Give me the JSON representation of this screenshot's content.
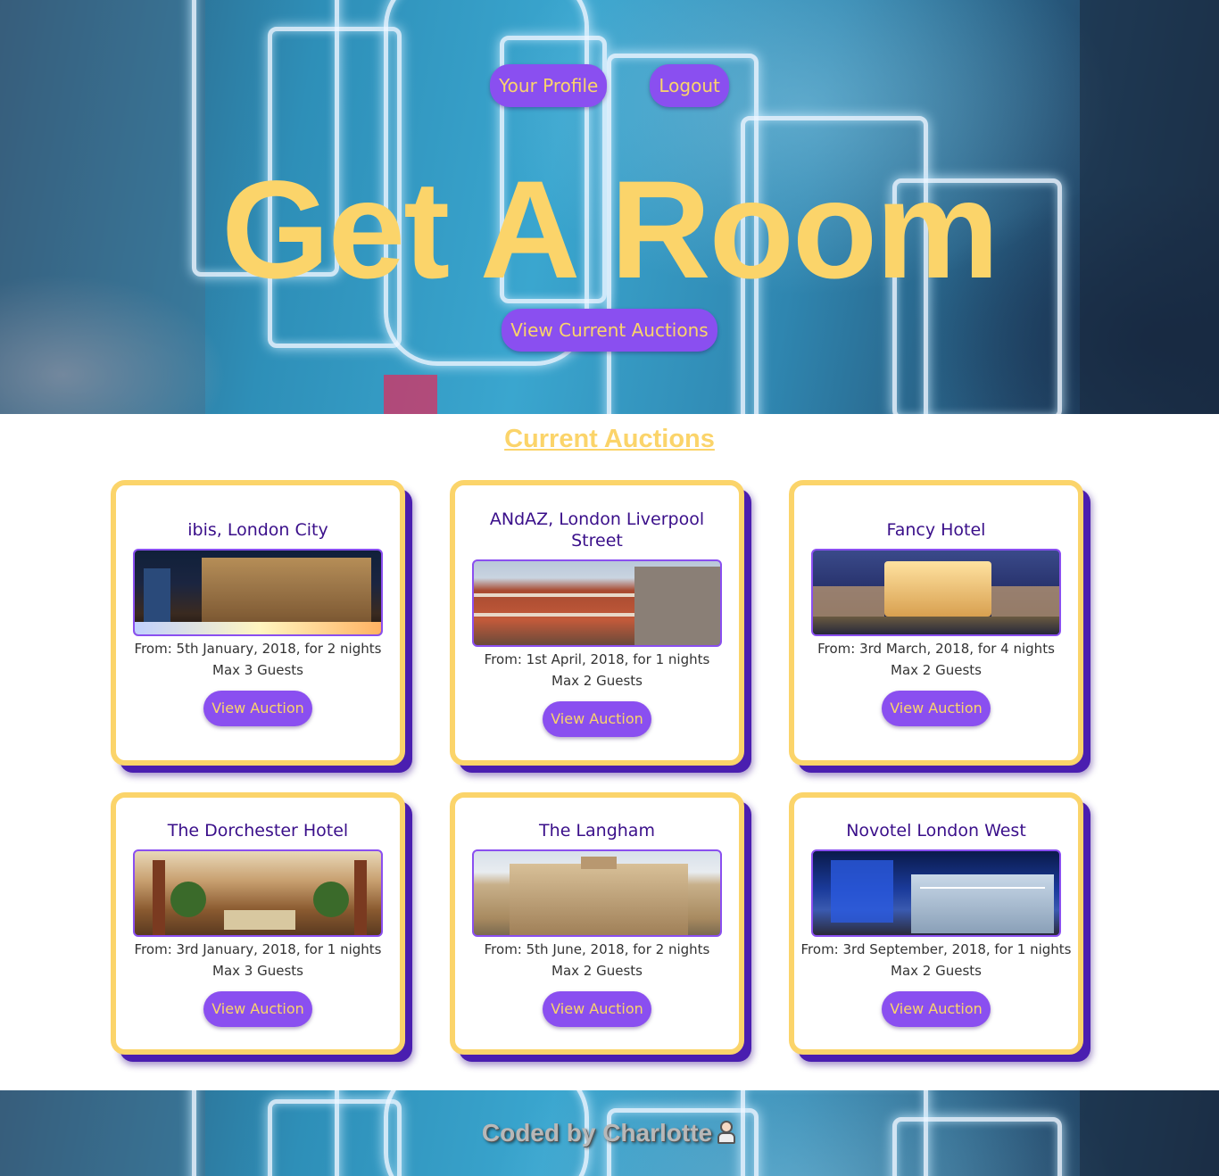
{
  "nav": {
    "profile_label": "Your Profile",
    "logout_label": "Logout"
  },
  "hero": {
    "title": "Get A Room",
    "cta_label": "View Current Auctions"
  },
  "section": {
    "title": "Current Auctions"
  },
  "auctions": [
    {
      "name": "ibis, London City",
      "from": "From: 5th January, 2018, for 2 nights",
      "guests": "Max 3 Guests",
      "button": "View Auction",
      "image": "city-night-hotel-photo"
    },
    {
      "name": "ANdAZ, London Liverpool Street",
      "from": "From: 1st April, 2018, for 1 nights",
      "guests": "Max 2 Guests",
      "button": "View Auction",
      "image": "red-brick-hotel-photo"
    },
    {
      "name": "Fancy Hotel",
      "from": "From: 3rd March, 2018, for 4 nights",
      "guests": "Max 2 Guests",
      "button": "View Auction",
      "image": "lit-palace-hotel-photo"
    },
    {
      "name": "The Dorchester Hotel",
      "from": "From: 3rd January, 2018, for 1 nights",
      "guests": "Max 3 Guests",
      "button": "View Auction",
      "image": "lobby-interior-photo"
    },
    {
      "name": "The Langham",
      "from": "From: 5th June, 2018, for 2 nights",
      "guests": "Max 2 Guests",
      "button": "View Auction",
      "image": "stone-facade-hotel-photo"
    },
    {
      "name": "Novotel London West",
      "from": "From: 3rd September, 2018, for 1 nights",
      "guests": "Max 2 Guests",
      "button": "View Auction",
      "image": "glass-modern-hotel-photo"
    }
  ],
  "footer": {
    "credit": "Coded by Charlotte",
    "emoji": "woman-technologist-emoji"
  },
  "colors": {
    "accent_purple": "#8a4ff0",
    "accent_yellow": "#fbd46a",
    "card_title": "#3a0f8a",
    "card_shadow": "#4a1eb0"
  }
}
